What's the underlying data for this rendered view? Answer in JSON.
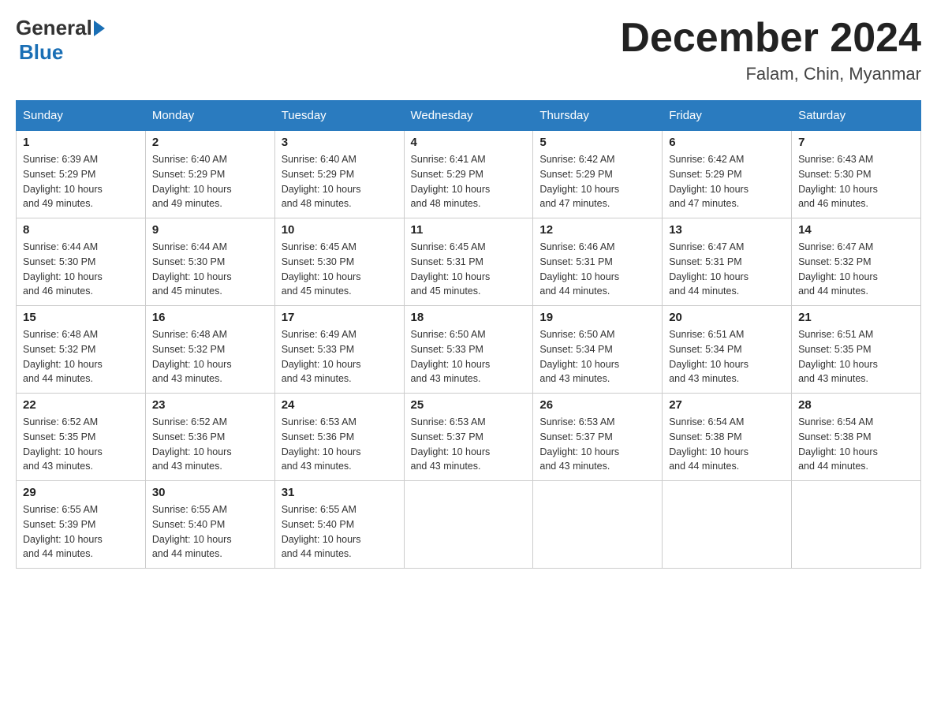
{
  "header": {
    "logo_general": "General",
    "logo_blue": "Blue",
    "month_title": "December 2024",
    "location": "Falam, Chin, Myanmar"
  },
  "days_of_week": [
    "Sunday",
    "Monday",
    "Tuesday",
    "Wednesday",
    "Thursday",
    "Friday",
    "Saturday"
  ],
  "weeks": [
    [
      {
        "day": "1",
        "sunrise": "6:39 AM",
        "sunset": "5:29 PM",
        "daylight": "10 hours and 49 minutes."
      },
      {
        "day": "2",
        "sunrise": "6:40 AM",
        "sunset": "5:29 PM",
        "daylight": "10 hours and 49 minutes."
      },
      {
        "day": "3",
        "sunrise": "6:40 AM",
        "sunset": "5:29 PM",
        "daylight": "10 hours and 48 minutes."
      },
      {
        "day": "4",
        "sunrise": "6:41 AM",
        "sunset": "5:29 PM",
        "daylight": "10 hours and 48 minutes."
      },
      {
        "day": "5",
        "sunrise": "6:42 AM",
        "sunset": "5:29 PM",
        "daylight": "10 hours and 47 minutes."
      },
      {
        "day": "6",
        "sunrise": "6:42 AM",
        "sunset": "5:29 PM",
        "daylight": "10 hours and 47 minutes."
      },
      {
        "day": "7",
        "sunrise": "6:43 AM",
        "sunset": "5:30 PM",
        "daylight": "10 hours and 46 minutes."
      }
    ],
    [
      {
        "day": "8",
        "sunrise": "6:44 AM",
        "sunset": "5:30 PM",
        "daylight": "10 hours and 46 minutes."
      },
      {
        "day": "9",
        "sunrise": "6:44 AM",
        "sunset": "5:30 PM",
        "daylight": "10 hours and 45 minutes."
      },
      {
        "day": "10",
        "sunrise": "6:45 AM",
        "sunset": "5:30 PM",
        "daylight": "10 hours and 45 minutes."
      },
      {
        "day": "11",
        "sunrise": "6:45 AM",
        "sunset": "5:31 PM",
        "daylight": "10 hours and 45 minutes."
      },
      {
        "day": "12",
        "sunrise": "6:46 AM",
        "sunset": "5:31 PM",
        "daylight": "10 hours and 44 minutes."
      },
      {
        "day": "13",
        "sunrise": "6:47 AM",
        "sunset": "5:31 PM",
        "daylight": "10 hours and 44 minutes."
      },
      {
        "day": "14",
        "sunrise": "6:47 AM",
        "sunset": "5:32 PM",
        "daylight": "10 hours and 44 minutes."
      }
    ],
    [
      {
        "day": "15",
        "sunrise": "6:48 AM",
        "sunset": "5:32 PM",
        "daylight": "10 hours and 44 minutes."
      },
      {
        "day": "16",
        "sunrise": "6:48 AM",
        "sunset": "5:32 PM",
        "daylight": "10 hours and 43 minutes."
      },
      {
        "day": "17",
        "sunrise": "6:49 AM",
        "sunset": "5:33 PM",
        "daylight": "10 hours and 43 minutes."
      },
      {
        "day": "18",
        "sunrise": "6:50 AM",
        "sunset": "5:33 PM",
        "daylight": "10 hours and 43 minutes."
      },
      {
        "day": "19",
        "sunrise": "6:50 AM",
        "sunset": "5:34 PM",
        "daylight": "10 hours and 43 minutes."
      },
      {
        "day": "20",
        "sunrise": "6:51 AM",
        "sunset": "5:34 PM",
        "daylight": "10 hours and 43 minutes."
      },
      {
        "day": "21",
        "sunrise": "6:51 AM",
        "sunset": "5:35 PM",
        "daylight": "10 hours and 43 minutes."
      }
    ],
    [
      {
        "day": "22",
        "sunrise": "6:52 AM",
        "sunset": "5:35 PM",
        "daylight": "10 hours and 43 minutes."
      },
      {
        "day": "23",
        "sunrise": "6:52 AM",
        "sunset": "5:36 PM",
        "daylight": "10 hours and 43 minutes."
      },
      {
        "day": "24",
        "sunrise": "6:53 AM",
        "sunset": "5:36 PM",
        "daylight": "10 hours and 43 minutes."
      },
      {
        "day": "25",
        "sunrise": "6:53 AM",
        "sunset": "5:37 PM",
        "daylight": "10 hours and 43 minutes."
      },
      {
        "day": "26",
        "sunrise": "6:53 AM",
        "sunset": "5:37 PM",
        "daylight": "10 hours and 43 minutes."
      },
      {
        "day": "27",
        "sunrise": "6:54 AM",
        "sunset": "5:38 PM",
        "daylight": "10 hours and 44 minutes."
      },
      {
        "day": "28",
        "sunrise": "6:54 AM",
        "sunset": "5:38 PM",
        "daylight": "10 hours and 44 minutes."
      }
    ],
    [
      {
        "day": "29",
        "sunrise": "6:55 AM",
        "sunset": "5:39 PM",
        "daylight": "10 hours and 44 minutes."
      },
      {
        "day": "30",
        "sunrise": "6:55 AM",
        "sunset": "5:40 PM",
        "daylight": "10 hours and 44 minutes."
      },
      {
        "day": "31",
        "sunrise": "6:55 AM",
        "sunset": "5:40 PM",
        "daylight": "10 hours and 44 minutes."
      },
      null,
      null,
      null,
      null
    ]
  ],
  "labels": {
    "sunrise": "Sunrise:",
    "sunset": "Sunset:",
    "daylight": "Daylight:"
  },
  "colors": {
    "header_bg": "#2a7bbf",
    "header_text": "#ffffff",
    "border": "#ccc",
    "text": "#333",
    "logo_blue": "#1a6fb5"
  }
}
